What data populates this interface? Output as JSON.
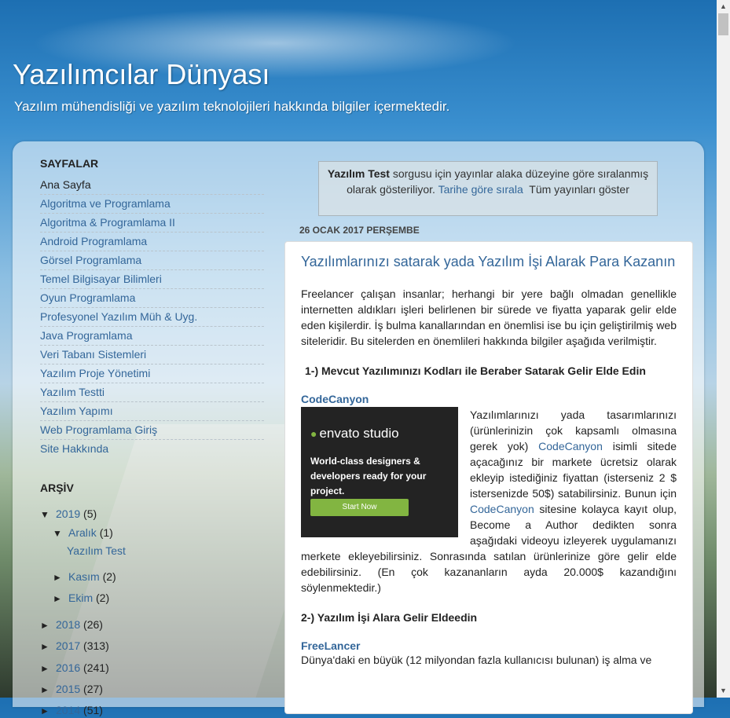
{
  "header": {
    "title": "Yazılımcılar Dünyası",
    "description": "Yazılım mühendisliği ve yazılım teknolojileri hakkında bilgiler içermektedir."
  },
  "sidebar": {
    "pages_title": "SAYFALAR",
    "pages": [
      {
        "label": "Ana Sayfa"
      },
      {
        "label": "Algoritma ve Programlama"
      },
      {
        "label": "Algoritma & Programlama II"
      },
      {
        "label": "Android Programlama"
      },
      {
        "label": "Görsel Programlama"
      },
      {
        "label": "Temel Bilgisayar Bilimleri"
      },
      {
        "label": "Oyun Programlama"
      },
      {
        "label": "Profesyonel Yazılım Müh & Uyg."
      },
      {
        "label": "Java Programlama"
      },
      {
        "label": "Veri Tabanı Sistemleri"
      },
      {
        "label": "Yazılım Proje Yönetimi"
      },
      {
        "label": "Yazılım Testti"
      },
      {
        "label": "Yazılım Yapımı"
      },
      {
        "label": "Web Programlama Giriş"
      },
      {
        "label": "Site Hakkında"
      }
    ],
    "archive_title": "ARŞİV",
    "archive": {
      "y2019": {
        "arrow": "▼",
        "label": "2019",
        "count": "(5)"
      },
      "aralik": {
        "arrow": "▼",
        "label": "Aralık",
        "count": "(1)"
      },
      "post": "Yazılım Test",
      "kasim": {
        "arrow": "►",
        "label": "Kasım",
        "count": "(2)"
      },
      "ekim": {
        "arrow": "►",
        "label": "Ekim",
        "count": "(2)"
      },
      "y2018": {
        "arrow": "►",
        "label": "2018",
        "count": "(26)"
      },
      "y2017": {
        "arrow": "►",
        "label": "2017",
        "count": "(313)"
      },
      "y2016": {
        "arrow": "►",
        "label": "2016",
        "count": "(241)"
      },
      "y2015": {
        "arrow": "►",
        "label": "2015",
        "count": "(27)"
      },
      "y2014": {
        "arrow": "►",
        "label": "2014",
        "count": "(51)"
      }
    }
  },
  "status": {
    "query": "Yazılım Test",
    "message": " sorgusu için yayınlar alaka düzeyine göre sıralanmış olarak gösteriliyor. ",
    "sort_link": "Tarihe göre sırala",
    "all_posts": "Tüm yayınları göster"
  },
  "date_header": "26 OCAK 2017 PERŞEMBE",
  "post": {
    "title": "Yazılımlarınızı satarak yada Yazılım İşi Alarak Para Kazanın",
    "intro": "Freelancer çalışan insanlar; herhangi bir yere bağlı olmadan genellikle internetten aldıkları işleri belirlenen bir sürede ve fiyatta  yaparak gelir elde eden kişilerdir. İş bulma kanallarından en önemlisi ise bu için geliştirilmiş web siteleridir. Bu sitelerden en önemlileri hakkında bilgiler aşağıda verilmiştir.",
    "h1": "1-) Mevcut Yazılımınızı Kodları ile Beraber Satarak Gelir Elde Edin",
    "codecanyon": "CodeCanyon",
    "cc_text_1": "Yazılımlarınızı yada tasarımlarınızı (ürünlerinizin çok kapsamlı olmasına gerek yok) ",
    "cc_link_1": "CodeCanyon",
    "cc_text_2": " isimli sitede açacağınız bir markete ücretsiz olarak ekleyip istediğiniz fiyattan (isterseniz 2 $ istersenizde 50$) satabilirsiniz. Bunun için ",
    "cc_link_2": "CodeCanyon",
    "cc_text_3": " sitesine kolayca kayıt olup, Become a Author dedikten sonra aşağıdaki videoyu izleyerek uygulamanızı merkete ekleyebilirsiniz. Sonrasında satılan ürünlerinize göre gelir elde edebilirsiniz. (En çok kazananların ayda 20.000$ kazandığını söylenmektedir.)",
    "h2": "2-) Yazılım İşi Alara Gelir Eldeedin",
    "freelancer": "FreeLancer",
    "fl_text": "Dünya'daki en büyük (12 milyondan fazla kullanıcısı bulunan) iş alma ve"
  },
  "ad": {
    "logo_text": "envato studio",
    "tagline": "World-class designers & developers ready for your project.",
    "button": "Start Now"
  },
  "colors": {
    "link": "#336699",
    "envato_green": "#82b541"
  }
}
